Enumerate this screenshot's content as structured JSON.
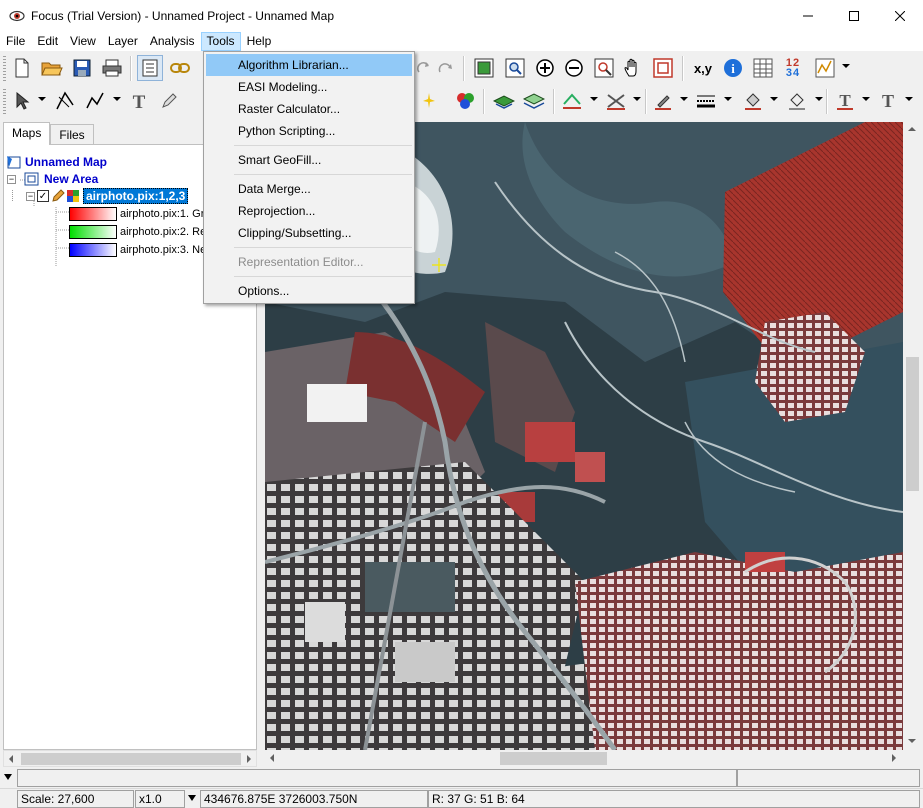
{
  "window": {
    "title": "Focus (Trial Version) - Unnamed Project - Unnamed Map"
  },
  "menubar": {
    "items": [
      "File",
      "Edit",
      "View",
      "Layer",
      "Analysis",
      "Tools",
      "Help"
    ],
    "active": "Tools"
  },
  "tools_menu": {
    "items": [
      {
        "label": "Algorithm Librarian...",
        "highlighted": true,
        "enabled": true
      },
      {
        "label": "EASI Modeling...",
        "enabled": true
      },
      {
        "label": "Raster Calculator...",
        "enabled": true
      },
      {
        "label": "Python Scripting...",
        "enabled": true
      },
      {
        "label": "Smart GeoFill...",
        "enabled": true
      },
      {
        "label": "Data Merge...",
        "enabled": true
      },
      {
        "label": "Reprojection...",
        "enabled": true
      },
      {
        "label": "Clipping/Subsetting...",
        "enabled": true
      },
      {
        "label": "Representation Editor...",
        "enabled": false
      },
      {
        "label": "Options...",
        "enabled": true
      }
    ]
  },
  "toolbar": {
    "coord_label": "x,y",
    "numbers_label_top": "12",
    "numbers_label_bottom": "34"
  },
  "left_panel": {
    "tabs": [
      "Maps",
      "Files"
    ],
    "selected_tab": "Maps",
    "tree": {
      "map": "Unnamed Map",
      "area": "New Area",
      "layer": "airphoto.pix:1,2,3",
      "bands": [
        {
          "label": "airphoto.pix:1. Gre",
          "color": "#ff0000"
        },
        {
          "label": "airphoto.pix:2. Re",
          "color": "#00dd00"
        },
        {
          "label": "airphoto.pix:3. Ne",
          "color": "#0000ff"
        }
      ]
    }
  },
  "status": {
    "scale": "Scale: 27,600",
    "zoom": "x1.0",
    "coordinates": "434676.875E 3726003.750N",
    "pixel_values": "R: 37 G: 51 B: 64"
  },
  "colors": {
    "menu_highlight": "#91c9f7",
    "selection": "#0078d7",
    "tree_text": "#0000cc"
  }
}
